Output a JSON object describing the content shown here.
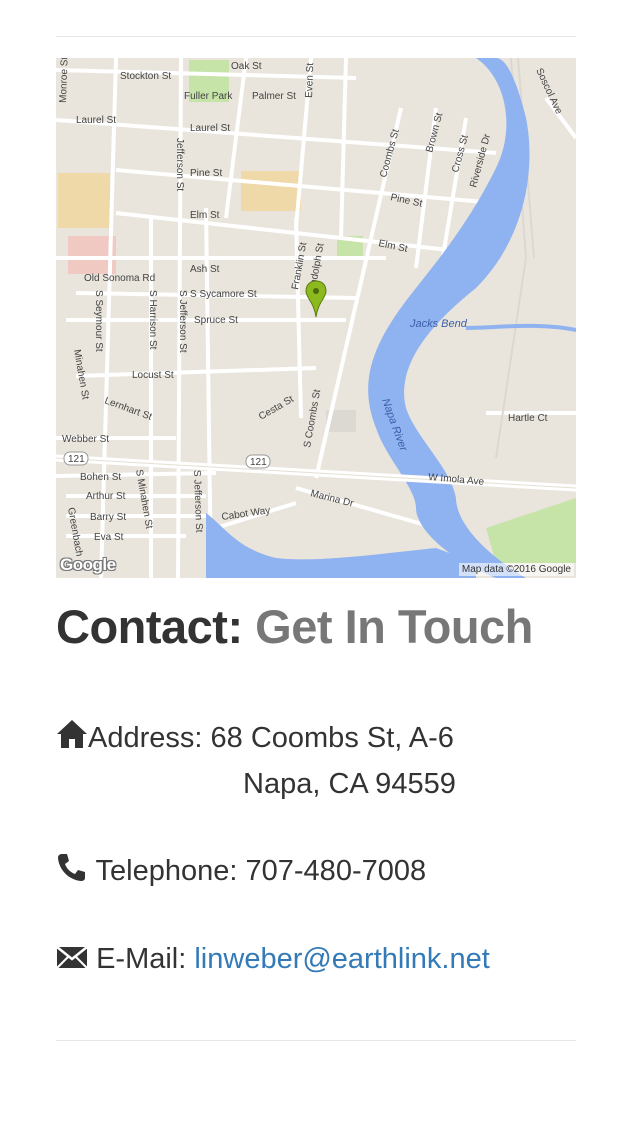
{
  "map": {
    "attribution": "Map data ©2016 Google",
    "logo": "Google",
    "streets": {
      "oak": "Oak St",
      "stockton": "Stockton St",
      "fuller_park": "Fuller Park",
      "palmer": "Palmer St",
      "even": "Even St",
      "monroe": "Monroe St",
      "laurel1": "Laurel St",
      "laurel2": "Laurel St",
      "jefferson": "Jefferson St",
      "pine1": "Pine St",
      "pine2": "Pine St",
      "elm1": "Elm St",
      "elm2": "Elm St",
      "coombs": "Coombs St",
      "brown": "Brown St",
      "cross": "Cross St",
      "riverside": "Riverside Dr",
      "soscol": "Soscol Ave",
      "ash": "Ash St",
      "franklin": "Franklin St",
      "randolph": "Randolph St",
      "old_sonoma": "Old Sonoma Rd",
      "sycamore": "S Sycamore St",
      "spruce": "Spruce St",
      "s_seymour": "S Seymour St",
      "s_harrison": "S Harrison St",
      "s_jefferson1": "S Jefferson St",
      "minahen1": "Minahen St",
      "locust": "Locust St",
      "lernhart": "Lernhart St",
      "cesta": "Cesta St",
      "s_coombs": "S Coombs St",
      "jacks_bend": "Jacks Bend",
      "napa_river": "Napa River",
      "hartle": "Hartle Ct",
      "webber": "Webber St",
      "route1": "121",
      "route2": "121",
      "w_imola": "W Imola Ave",
      "bohen": "Bohen St",
      "s_minahen": "S Minahen St",
      "s_jefferson2": "S Jefferson St",
      "arthur": "Arthur St",
      "marina": "Marina Dr",
      "barry": "Barry St",
      "cabot": "Cabot Way",
      "eva": "Eva St",
      "greenbach": "Greenbach"
    }
  },
  "heading": {
    "main": "Contact:",
    "sub": "Get In Touch"
  },
  "contact": {
    "address_label": "Address:",
    "address_line1": "68 Coombs St, A-6",
    "address_line2": "Napa, CA 94559",
    "phone_label": "Telephone:",
    "phone_value": "707-480-7008",
    "email_label": "E-Mail:",
    "email_value": "linweber@earthlink.net"
  },
  "icons": {
    "address": "home-icon",
    "phone": "phone-icon",
    "email": "envelope-icon"
  },
  "colors": {
    "heading_main": "#333333",
    "heading_sub": "#777777",
    "link": "#337ab7",
    "marker": "#8cb91d",
    "water": "#8fb2f0",
    "park": "#c6e3a8"
  }
}
